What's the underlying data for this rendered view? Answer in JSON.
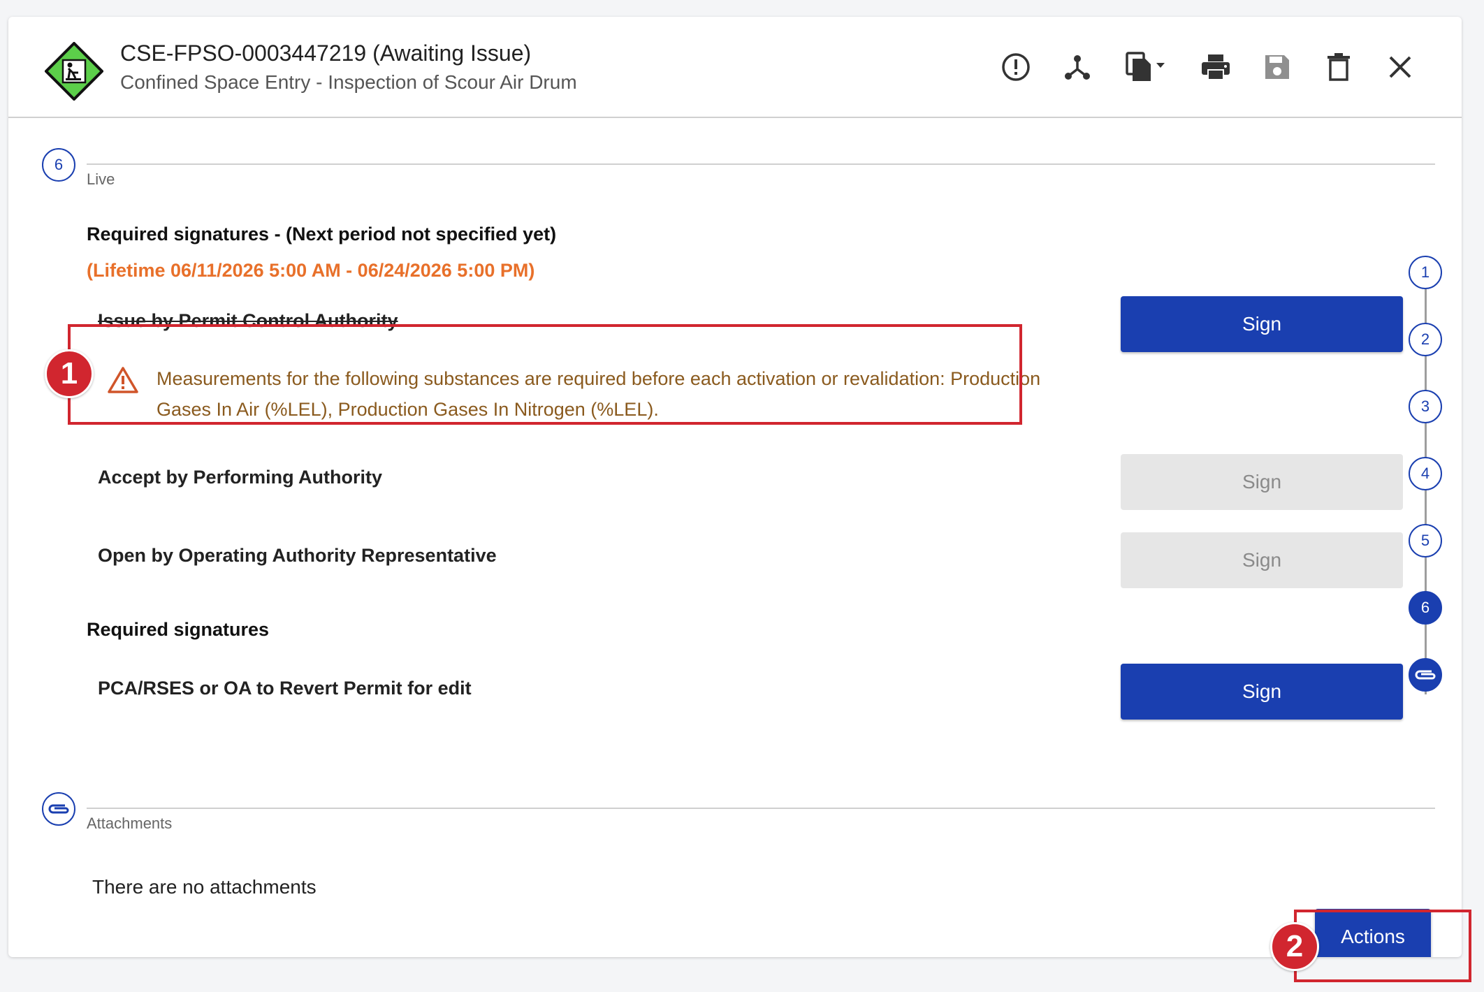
{
  "header": {
    "title": "CSE-FPSO-0003447219 (Awaiting Issue)",
    "subtitle": "Confined Space Entry - Inspection of Scour Air Drum",
    "tools": [
      "alert-icon",
      "workflow-icon",
      "copy-dropdown-icon",
      "print-icon",
      "save-icon",
      "delete-icon",
      "close-icon"
    ]
  },
  "live_section": {
    "badge": "6",
    "label": "Live",
    "required_heading": "Required signatures - (Next period not specified yet)",
    "lifetime": "(Lifetime 06/11/2026 5:00 AM - 06/24/2026 5:00 PM)",
    "signatures": [
      {
        "label": "Issue by Permit Control Authority",
        "button": "Sign",
        "state": "enabled"
      },
      {
        "label": "Accept by Performing Authority",
        "button": "Sign",
        "state": "disabled"
      },
      {
        "label": "Open by Operating Authority Representative",
        "button": "Sign",
        "state": "disabled"
      }
    ],
    "warning": "Measurements for the following substances are required before each activation or revalidation: Production Gases In Air (%LEL), Production Gases In Nitrogen (%LEL).",
    "required_heading_2": "Required signatures",
    "revert": {
      "label": "PCA/RSES or OA to Revert Permit for edit",
      "button": "Sign"
    }
  },
  "stepper": {
    "steps": [
      "1",
      "2",
      "3",
      "4",
      "5",
      "6"
    ],
    "active": "6",
    "last_icon": "paperclip-icon"
  },
  "attachments": {
    "label": "Attachments",
    "empty_text": "There are no attachments"
  },
  "actions": {
    "label": "Actions"
  },
  "annotations": [
    "1",
    "2"
  ],
  "colors": {
    "primary": "#1a3fb0",
    "lifetime": "#e8702a",
    "warning_text": "#8a5a1e",
    "annotation": "#d1262f",
    "logo_green": "#5ccf4a"
  }
}
